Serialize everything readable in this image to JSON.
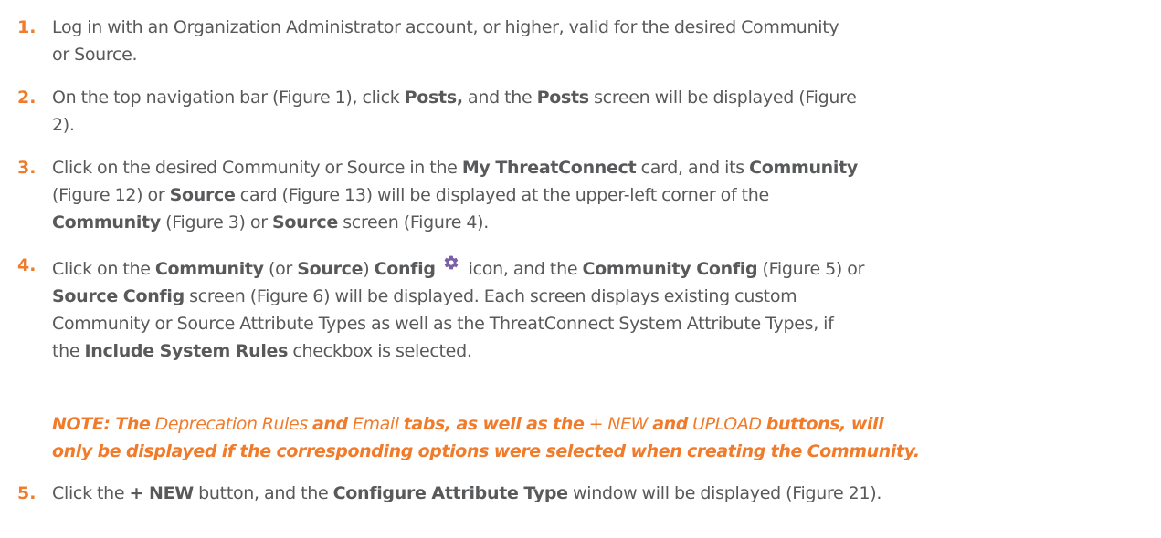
{
  "steps": [
    {
      "number": "1.",
      "line1": "Log in with an Organization Administrator account, or higher, valid for the desired Community",
      "line2": "or Source."
    },
    {
      "number": "2.",
      "t1": "On the top navigation bar (Figure 1), click ",
      "b1": "Posts,",
      "t2": " and the ",
      "b2": "Posts",
      "t3": " screen will be displayed (Figure",
      "line2": "2)."
    },
    {
      "number": "3.",
      "t1": "Click on the desired Community or Source in the ",
      "b1": "My ThreatConnect",
      "t2": " card, and its ",
      "b2": "Community",
      "t3": "(Figure 12) or ",
      "b3": "Source",
      "t4": " card (Figure 13) will be displayed at the upper-left corner of the",
      "b4": "Community",
      "t5": " (Figure 3) or ",
      "b5": "Source",
      "t6": " screen (Figure 4)."
    },
    {
      "number": "4.",
      "t1": "Click on the ",
      "b1": "Community",
      "t2": " (or ",
      "b2": "Source",
      "t3": ") ",
      "b3": "Config",
      "icon": "gear-icon",
      "t4": "icon, and the ",
      "b4": "Community Config",
      "t5": " (Figure 5) or",
      "b5": "Source Config",
      "t6": " screen (Figure 6) will be displayed. Each screen displays existing custom",
      "line3": "Community or Source Attribute Types as well as the ThreatConnect System Attribute Types, if",
      "t7": "the ",
      "b6": "Include System Rules",
      "t8": " checkbox is selected."
    },
    {
      "number": "5.",
      "t1": "Click the ",
      "b1": "+ NEW",
      "t2": " button, and the ",
      "b2": "Configure Attribute Type",
      "t3": " window will be displayed (Figure 21)."
    }
  ],
  "note": {
    "b1": "NOTE: The",
    "p1": " Deprecation Rules ",
    "b2": "and",
    "p2": " Email ",
    "b3": "tabs, as well as the",
    "p3": " + NEW ",
    "b4": "and",
    "p4": " UPLOAD ",
    "b5": "buttons, will",
    "line2": "only be displayed if the corresponding options were selected when creating the Community."
  },
  "colors": {
    "accent": "#f07c2b",
    "text": "#58595b"
  }
}
